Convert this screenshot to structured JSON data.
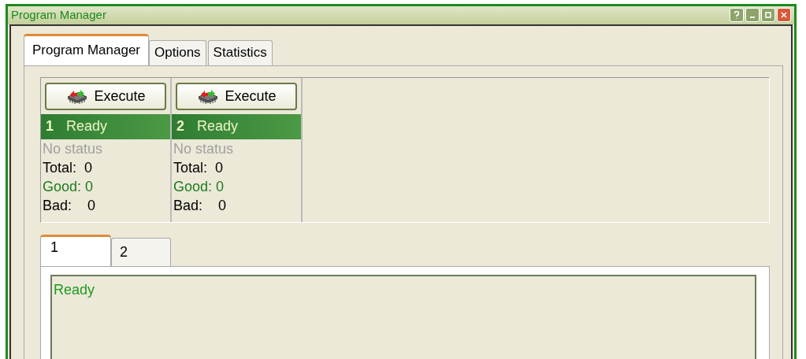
{
  "window": {
    "title": "Program Manager"
  },
  "tabs": [
    {
      "label": "Program Manager",
      "selected": true
    },
    {
      "label": "Options",
      "selected": false
    },
    {
      "label": "Statistics",
      "selected": false
    }
  ],
  "stations": [
    {
      "button": "Execute",
      "number": "1",
      "state": "Ready",
      "status": "No status",
      "total": "Total:  0",
      "good": "Good: 0",
      "bad": "Bad:    0"
    },
    {
      "button": "Execute",
      "number": "2",
      "state": "Ready",
      "status": "No status",
      "total": "Total:  0",
      "good": "Good: 0",
      "bad": "Bad:    0"
    }
  ],
  "log_tabs": [
    {
      "label": "1",
      "selected": true
    },
    {
      "label": "2",
      "selected": false
    }
  ],
  "log": {
    "text": "Ready"
  }
}
